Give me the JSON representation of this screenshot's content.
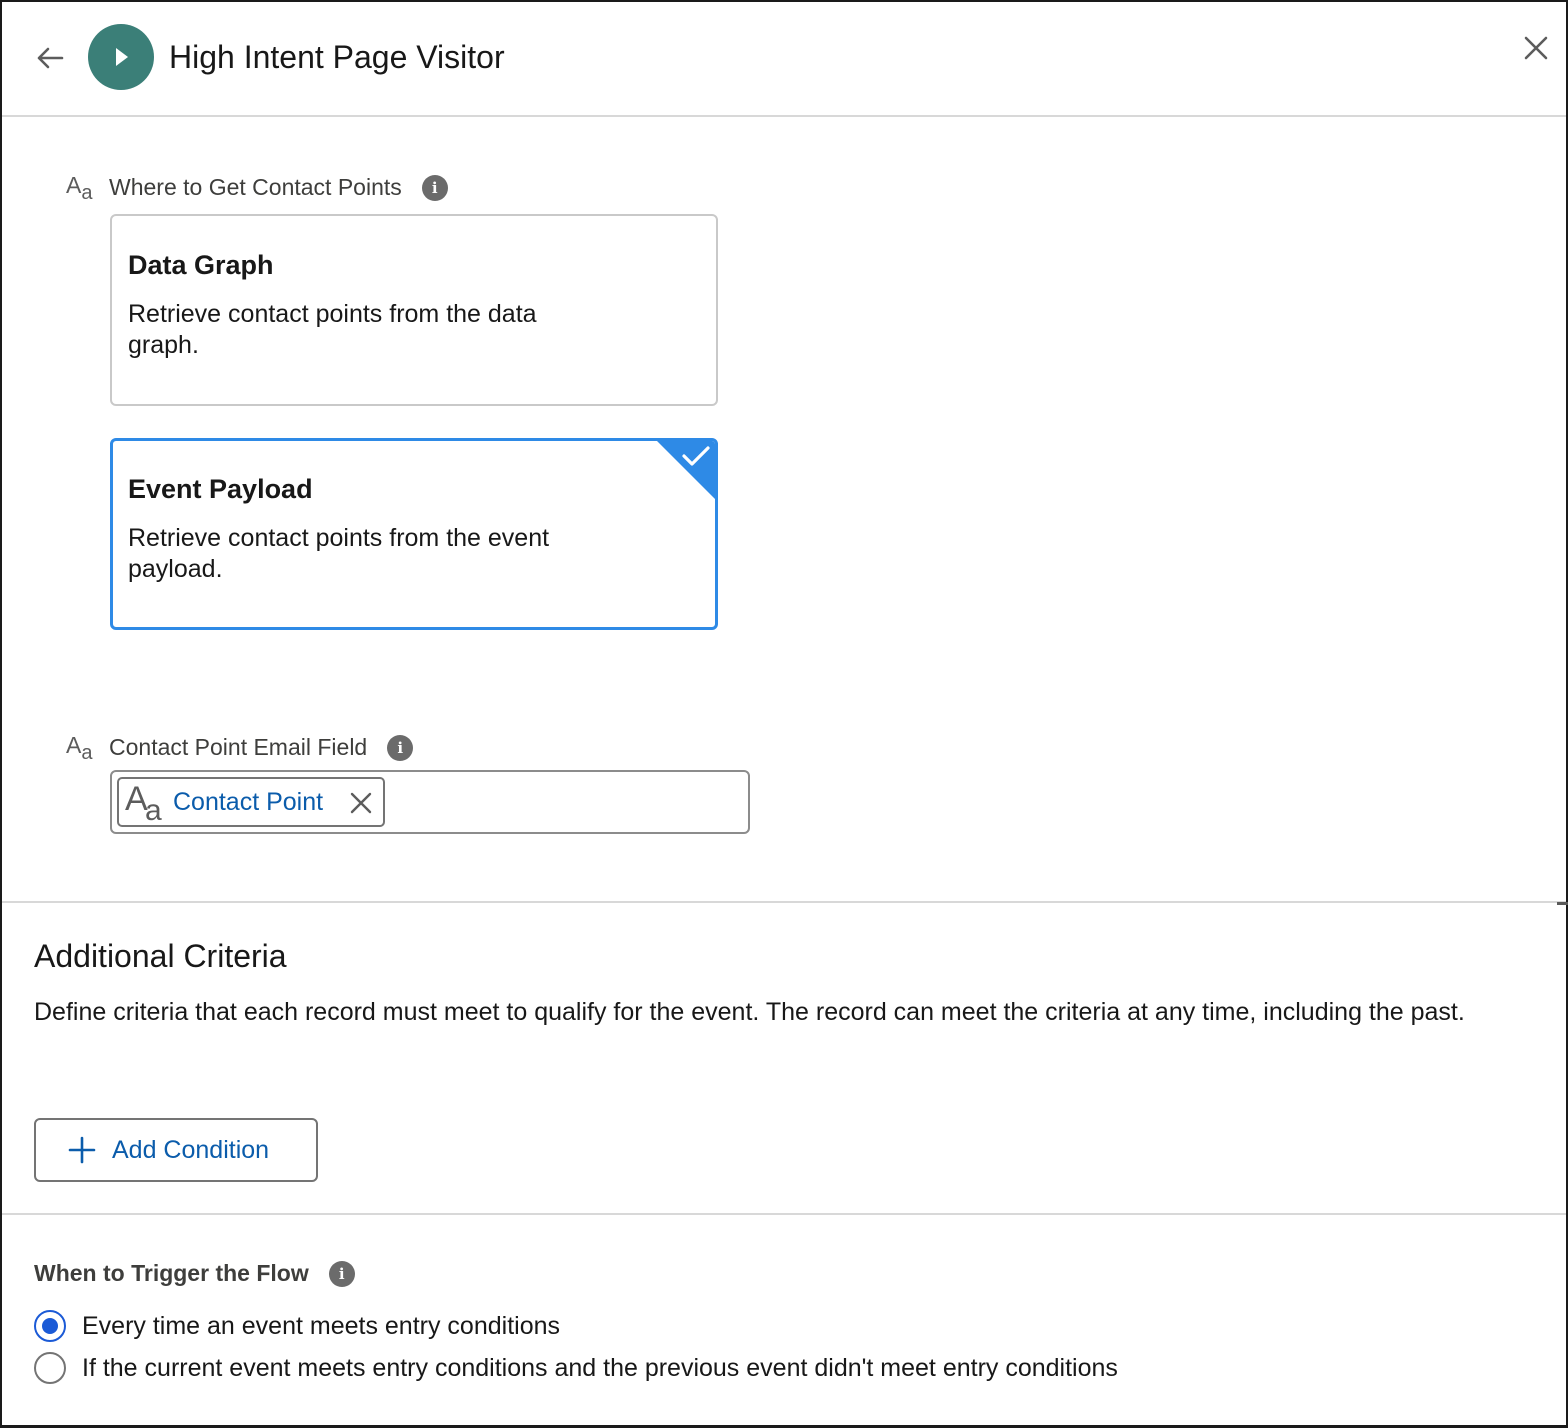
{
  "header": {
    "title": "High Intent Page Visitor"
  },
  "contact_source": {
    "label": "Where to Get Contact Points",
    "options": [
      {
        "title": "Data Graph",
        "description": "Retrieve contact points from the data graph.",
        "selected": false
      },
      {
        "title": "Event Payload",
        "description": "Retrieve contact points from the event payload.",
        "selected": true
      }
    ]
  },
  "email_field": {
    "label": "Contact Point Email Field",
    "pill_label": "Contact Point"
  },
  "additional_criteria": {
    "title": "Additional Criteria",
    "description": "Define criteria that each record must meet to qualify for the event. The record can meet the criteria at any time, including the past.",
    "add_button_label": "Add Condition"
  },
  "trigger": {
    "title": "When to Trigger the Flow",
    "options": [
      {
        "label": "Every time an event meets entry conditions",
        "checked": true
      },
      {
        "label": "If the current event meets entry conditions and the previous event didn't meet entry conditions",
        "checked": false
      }
    ]
  },
  "colors": {
    "flow_icon": "#3b7f78",
    "selected_border": "#2e8ae6",
    "link_blue": "#0b5cab",
    "radio_blue": "#1b5ad6"
  },
  "icons": {
    "back": "arrow-left-icon",
    "flow": "play-icon",
    "close": "close-icon",
    "text_type": "text-type-icon",
    "info": "info-icon",
    "check": "checkmark-icon",
    "remove": "remove-icon",
    "add": "plus-icon"
  }
}
